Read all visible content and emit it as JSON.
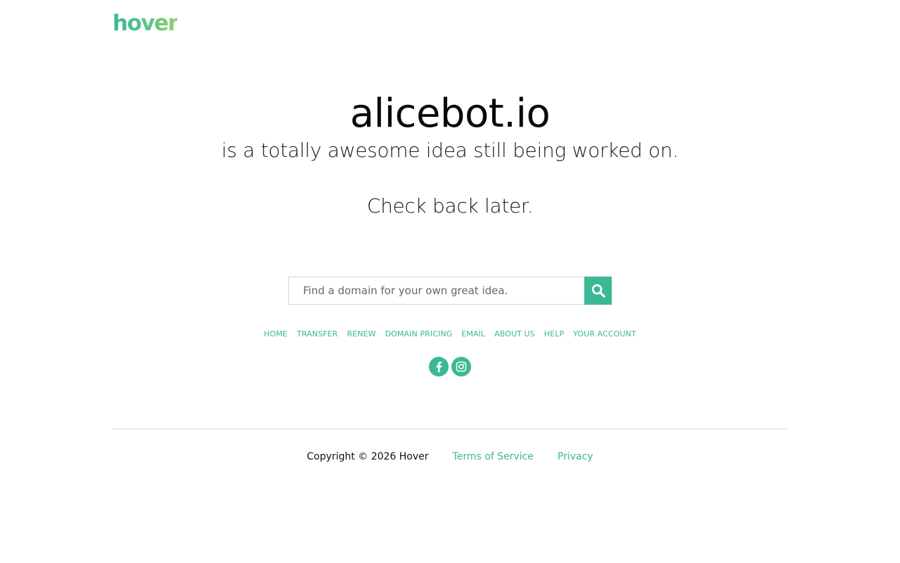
{
  "header": {
    "logo_text": "hover"
  },
  "hero": {
    "domain": "alicebot.io",
    "subtitle": "is a totally awesome idea still being worked on.",
    "check_back": "Check back later."
  },
  "search": {
    "placeholder": "Find a domain for your own great idea.",
    "value": "",
    "button_icon": "search-icon"
  },
  "nav": {
    "items": [
      {
        "label": "HOME"
      },
      {
        "label": "TRANSFER"
      },
      {
        "label": "RENEW"
      },
      {
        "label": "DOMAIN PRICING"
      },
      {
        "label": "EMAIL"
      },
      {
        "label": "ABOUT US"
      },
      {
        "label": "HELP"
      },
      {
        "label": "YOUR ACCOUNT"
      }
    ]
  },
  "social": {
    "items": [
      {
        "icon": "facebook-icon"
      },
      {
        "icon": "instagram-icon"
      }
    ]
  },
  "footer": {
    "copyright": "Copyright © 2026 Hover",
    "terms_label": "Terms of Service",
    "privacy_label": "Privacy"
  },
  "colors": {
    "accent": "#3bb894",
    "logo_gradient_start": "#3cb896",
    "logo_gradient_end": "#8fd165",
    "text": "#111111",
    "divider": "#dcdcdc"
  }
}
